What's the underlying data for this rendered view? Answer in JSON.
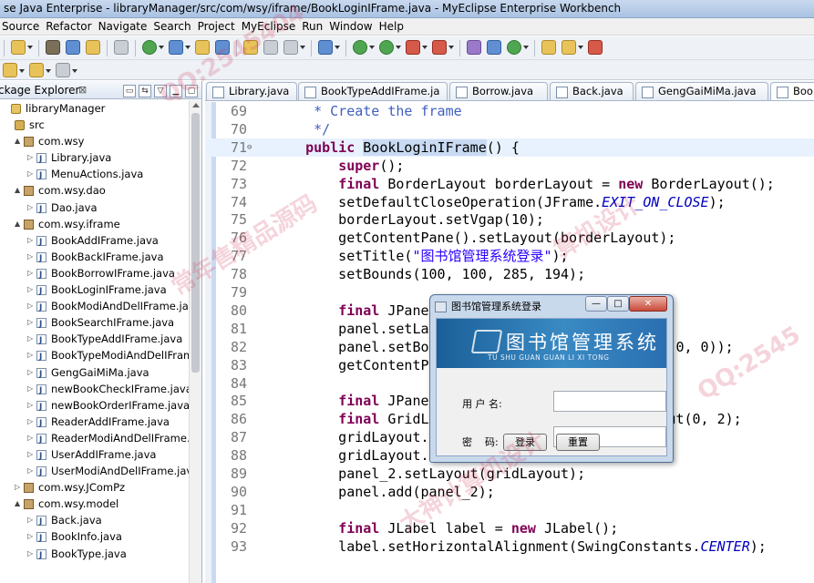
{
  "window": {
    "title": "se Java Enterprise - libraryManager/src/com/wsy/iframe/BookLoginIFrame.java - MyEclipse Enterprise Workbench"
  },
  "menu": [
    "Source",
    "Refactor",
    "Navigate",
    "Search",
    "Project",
    "MyEclipse",
    "Run",
    "Window",
    "Help"
  ],
  "package_explorer": {
    "title": "ckage Explorer",
    "close_glyph": "⊠",
    "tree": [
      {
        "label": "libraryManager",
        "level": 0,
        "icon": "project",
        "twisty": ""
      },
      {
        "label": "src",
        "level": 1,
        "icon": "src",
        "twisty": ""
      },
      {
        "label": "com.wsy",
        "level": 2,
        "icon": "package",
        "twisty": "▲"
      },
      {
        "label": "Library.java",
        "level": 3,
        "icon": "java",
        "twisty": "▷"
      },
      {
        "label": "MenuActions.java",
        "level": 3,
        "icon": "java",
        "twisty": "▷"
      },
      {
        "label": "com.wsy.dao",
        "level": 2,
        "icon": "package",
        "twisty": "▲"
      },
      {
        "label": "Dao.java",
        "level": 3,
        "icon": "java",
        "twisty": "▷"
      },
      {
        "label": "com.wsy.iframe",
        "level": 2,
        "icon": "package",
        "twisty": "▲"
      },
      {
        "label": "BookAddIFrame.java",
        "level": 3,
        "icon": "java",
        "twisty": "▷"
      },
      {
        "label": "BookBackIFrame.java",
        "level": 3,
        "icon": "java",
        "twisty": "▷"
      },
      {
        "label": "BookBorrowIFrame.java",
        "level": 3,
        "icon": "java",
        "twisty": "▷"
      },
      {
        "label": "BookLoginIFrame.java",
        "level": 3,
        "icon": "java",
        "twisty": "▷"
      },
      {
        "label": "BookModiAndDelIFrame.jav",
        "level": 3,
        "icon": "java",
        "twisty": "▷"
      },
      {
        "label": "BookSearchIFrame.java",
        "level": 3,
        "icon": "java",
        "twisty": "▷"
      },
      {
        "label": "BookTypeAddIFrame.java",
        "level": 3,
        "icon": "java",
        "twisty": "▷"
      },
      {
        "label": "BookTypeModiAndDelIFram",
        "level": 3,
        "icon": "java",
        "twisty": "▷"
      },
      {
        "label": "GengGaiMiMa.java",
        "level": 3,
        "icon": "java",
        "twisty": "▷"
      },
      {
        "label": "newBookCheckIFrame.java",
        "level": 3,
        "icon": "java",
        "twisty": "▷"
      },
      {
        "label": "newBookOrderIFrame.java",
        "level": 3,
        "icon": "java",
        "twisty": "▷"
      },
      {
        "label": "ReaderAddIFrame.java",
        "level": 3,
        "icon": "java",
        "twisty": "▷"
      },
      {
        "label": "ReaderModiAndDelIFrame.j",
        "level": 3,
        "icon": "java",
        "twisty": "▷"
      },
      {
        "label": "UserAddIFrame.java",
        "level": 3,
        "icon": "java",
        "twisty": "▷"
      },
      {
        "label": "UserModiAndDelIFrame.java",
        "level": 3,
        "icon": "java",
        "twisty": "▷"
      },
      {
        "label": "com.wsy.JComPz",
        "level": 2,
        "icon": "package",
        "twisty": "▷"
      },
      {
        "label": "com.wsy.model",
        "level": 2,
        "icon": "package",
        "twisty": "▲"
      },
      {
        "label": "Back.java",
        "level": 3,
        "icon": "java",
        "twisty": "▷"
      },
      {
        "label": "BookInfo.java",
        "level": 3,
        "icon": "java",
        "twisty": "▷"
      },
      {
        "label": "BookType.java",
        "level": 3,
        "icon": "java",
        "twisty": "▷"
      }
    ]
  },
  "editor_tabs": [
    {
      "label": "Library.java",
      "active": false
    },
    {
      "label": "BookTypeAddIFrame.ja",
      "active": false
    },
    {
      "label": "Borrow.java",
      "active": false
    },
    {
      "label": "Back.java",
      "active": false
    },
    {
      "label": "GengGaiMiMa.java",
      "active": false
    },
    {
      "label": "Bool",
      "active": true
    }
  ],
  "code_lines": [
    {
      "num": "69",
      "parts": [
        [
          "cm",
          "   * Create the frame"
        ]
      ]
    },
    {
      "num": "70",
      "parts": [
        [
          "cm",
          "   */"
        ]
      ]
    },
    {
      "num": "71",
      "fold": "⊖",
      "current": true,
      "parts": [
        [
          "t",
          "  "
        ],
        [
          "kw",
          "public"
        ],
        [
          "t",
          " "
        ],
        [
          "sel",
          "BookLoginIFrame"
        ],
        [
          "t",
          "() {"
        ]
      ]
    },
    {
      "num": "72",
      "parts": [
        [
          "t",
          "      "
        ],
        [
          "kw",
          "super"
        ],
        [
          "t",
          "();"
        ]
      ]
    },
    {
      "num": "73",
      "parts": [
        [
          "t",
          "      "
        ],
        [
          "kw",
          "final"
        ],
        [
          "t",
          " BorderLayout borderLayout = "
        ],
        [
          "kw",
          "new"
        ],
        [
          "t",
          " BorderLayout();"
        ]
      ]
    },
    {
      "num": "74",
      "parts": [
        [
          "t",
          "      setDefaultCloseOperation(JFrame."
        ],
        [
          "itf",
          "EXIT_ON_CLOSE"
        ],
        [
          "t",
          ");"
        ]
      ]
    },
    {
      "num": "75",
      "parts": [
        [
          "t",
          "      borderLayout.setVgap(10);"
        ]
      ]
    },
    {
      "num": "76",
      "parts": [
        [
          "t",
          "      getContentPane().setLayout(borderLayout);"
        ]
      ]
    },
    {
      "num": "77",
      "parts": [
        [
          "t",
          "      setTitle("
        ],
        [
          "str",
          "\"图书馆管理系统登录\""
        ],
        [
          "t",
          ");"
        ]
      ]
    },
    {
      "num": "78",
      "parts": [
        [
          "t",
          "      setBounds(100, 100, 285, 194);"
        ]
      ]
    },
    {
      "num": "79",
      "parts": [
        [
          "t",
          ""
        ]
      ]
    },
    {
      "num": "80",
      "parts": [
        [
          "t",
          "      "
        ],
        [
          "kw",
          "final"
        ],
        [
          "t",
          " JPanel"
        ]
      ]
    },
    {
      "num": "81",
      "parts": [
        [
          "t",
          "      panel.setLay"
        ]
      ]
    },
    {
      "num": "82",
      "parts": [
        [
          "t",
          "      panel.setBor                             0, 0));"
        ]
      ]
    },
    {
      "num": "83",
      "parts": [
        [
          "t",
          "      getContentPa"
        ]
      ]
    },
    {
      "num": "84",
      "parts": [
        [
          "t",
          ""
        ]
      ]
    },
    {
      "num": "85",
      "parts": [
        [
          "t",
          "      "
        ],
        [
          "kw",
          "final"
        ],
        [
          "t",
          " JPanel"
        ]
      ]
    },
    {
      "num": "86",
      "parts": [
        [
          "t",
          "      "
        ],
        [
          "kw",
          "final"
        ],
        [
          "t",
          " GridLa                        Layout(0, 2);"
        ]
      ]
    },
    {
      "num": "87",
      "parts": [
        [
          "t",
          "      gridLayout.s"
        ]
      ]
    },
    {
      "num": "88",
      "parts": [
        [
          "t",
          "      gridLayout.s"
        ]
      ]
    },
    {
      "num": "89",
      "parts": [
        [
          "t",
          "      panel_2.setLayout(gridLayout);"
        ]
      ]
    },
    {
      "num": "90",
      "parts": [
        [
          "t",
          "      panel.add(panel_2);"
        ]
      ]
    },
    {
      "num": "91",
      "parts": [
        [
          "t",
          ""
        ]
      ]
    },
    {
      "num": "92",
      "parts": [
        [
          "t",
          "      "
        ],
        [
          "kw",
          "final"
        ],
        [
          "t",
          " JLabel label = "
        ],
        [
          "kw",
          "new"
        ],
        [
          "t",
          " JLabel();"
        ]
      ]
    },
    {
      "num": "93",
      "parts": [
        [
          "t",
          "      label.setHorizontalAlignment(SwingConstants."
        ],
        [
          "itf",
          "CENTER"
        ],
        [
          "t",
          ");"
        ]
      ]
    }
  ],
  "dialog": {
    "title": "图书馆管理系统登录",
    "banner_cn": "图书馆管理系统",
    "banner_en": "TU SHU GUAN GUAN LI XI TONG",
    "user_label": "用 户 名:",
    "password_label": "密    码:",
    "username_value": "",
    "password_value": "",
    "login_button": "登录",
    "reset_button": "重置",
    "minimize_glyph": "—",
    "maximize_glyph": "□",
    "close_glyph": "✕"
  },
  "watermarks": [
    "QQ:2545404",
    "常年售精品源码",
    "算机设计",
    "QQ:2545",
    "大神计算机设计"
  ]
}
